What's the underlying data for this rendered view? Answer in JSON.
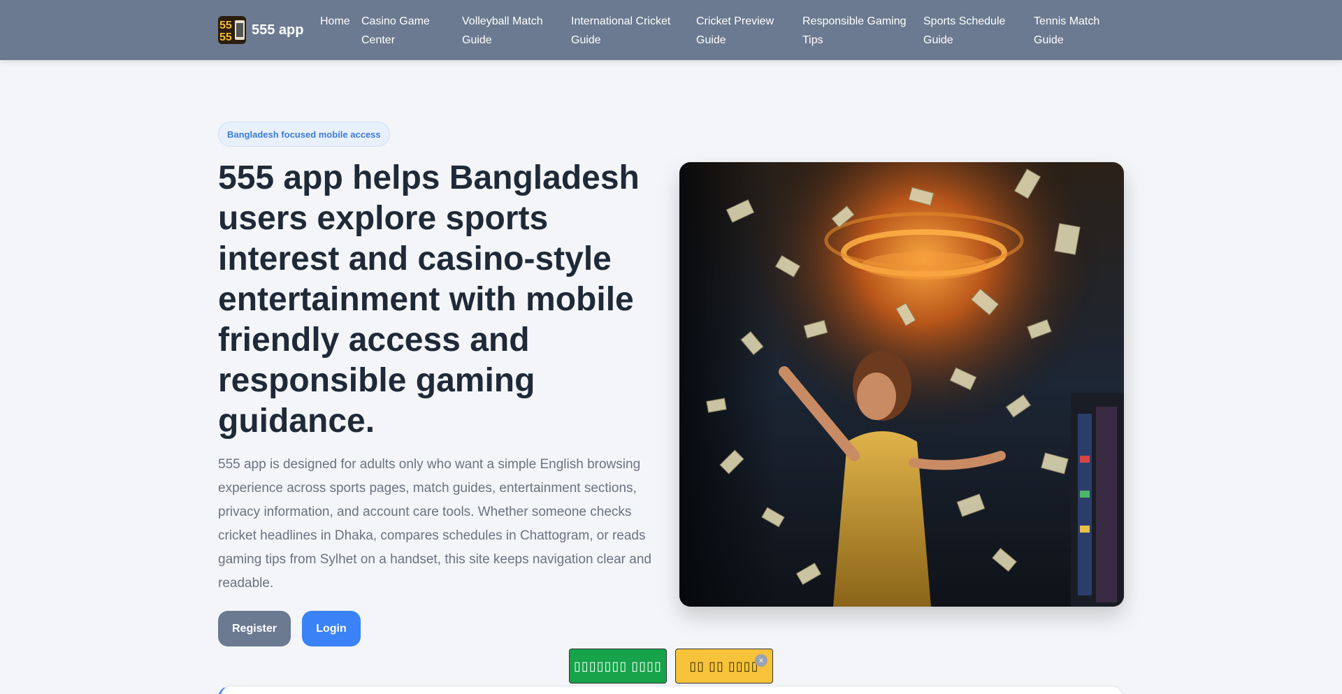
{
  "header": {
    "brand": "555 app",
    "nav": [
      "Home",
      "Casino Game Center",
      "Volleyball Match Guide",
      "International Cricket Guide",
      "Cricket Preview Guide",
      "Responsible Gaming Tips",
      "Sports Schedule Guide",
      "Tennis Match Guide"
    ]
  },
  "hero": {
    "badge": "Bangladesh focused mobile access",
    "title": "555 app helps Bangladesh users explore sports interest and casino-style entertainment with mobile friendly access and responsible gaming guidance.",
    "description": "555 app is designed for adults only who want a simple English browsing experience across sports pages, match guides, entertainment sections, privacy information, and account care tools. Whether someone checks cricket headlines in Dhaka, compares schedules in Chattogram, or reads gaming tips from Sylhet on a handset, this site keeps navigation clear and readable.",
    "register_label": "Register",
    "login_label": "Login"
  },
  "promos": {
    "green_label": "▯▯▯▯▯▯▯ ▯▯▯▯",
    "yellow_label": "▯▯ ▯▯ ▯▯▯▯",
    "close_glyph": "×"
  },
  "colors": {
    "header_bg": "#6b7a90",
    "accent_blue": "#3b82f6",
    "promo_green": "#16a34a",
    "promo_yellow": "#f6c33a"
  }
}
